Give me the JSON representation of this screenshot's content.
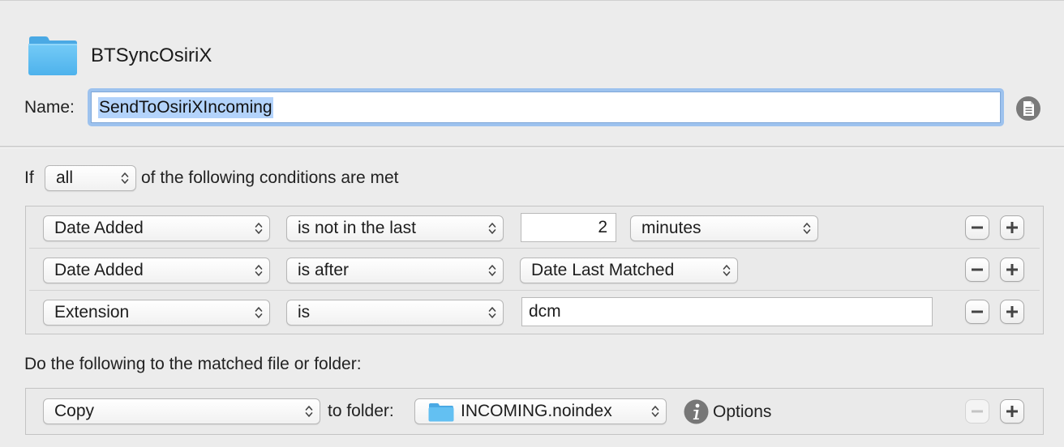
{
  "header": {
    "folder_icon": "folder-icon",
    "folder_name": "BTSyncOsiriX",
    "name_label": "Name:",
    "name_value": "SendToOsiriXIncoming",
    "script_icon": "script-icon"
  },
  "conditions": {
    "if_label": "If",
    "match_mode": "all",
    "match_text": "of the following conditions are met",
    "rows": [
      {
        "attribute": "Date Added",
        "operator": "is not in the last",
        "value": "2",
        "unit": "minutes"
      },
      {
        "attribute": "Date Added",
        "operator": "is after",
        "value": "Date Last Matched"
      },
      {
        "attribute": "Extension",
        "operator": "is",
        "value": "dcm"
      }
    ]
  },
  "actions": {
    "label": "Do the following to the matched file or folder:",
    "rows": [
      {
        "action": "Copy",
        "to_folder_label": "to folder:",
        "folder": "INCOMING.noindex",
        "options_label": "Options"
      }
    ]
  },
  "colors": {
    "background": "#ececec",
    "focus_ring": "#9dc2ee",
    "selection": "#b3d3fb",
    "folder_blue": "#5ab8ee",
    "icon_gray": "#777777"
  }
}
